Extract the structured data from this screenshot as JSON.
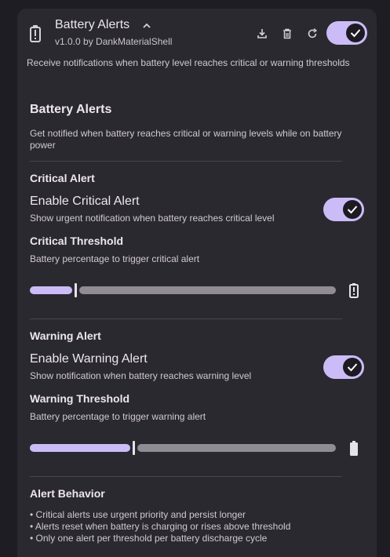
{
  "plugin": {
    "title": "Battery Alerts",
    "version": "v1.0.0 by DankMaterialShell",
    "description": "Receive notifications when battery level reaches critical or warning thresholds",
    "enabled": true,
    "icons": [
      "battery-alert-icon",
      "download-icon",
      "trash-icon",
      "refresh-icon",
      "check-icon"
    ]
  },
  "settings": {
    "title": "Battery Alerts",
    "description": "Get notified when battery reaches critical or warning levels while on battery power",
    "critical": {
      "heading": "Critical Alert",
      "enable_title": "Enable Critical Alert",
      "enable_desc": "Show urgent notification when battery reaches critical level",
      "enabled": true,
      "threshold_title": "Critical Threshold",
      "threshold_desc": "Battery percentage to trigger critical alert",
      "threshold_fraction": 0.145
    },
    "warning": {
      "heading": "Warning Alert",
      "enable_title": "Enable Warning Alert",
      "enable_desc": "Show notification when battery reaches warning level",
      "enabled": true,
      "threshold_title": "Warning Threshold",
      "threshold_desc": "Battery percentage to trigger warning alert",
      "threshold_fraction": 0.335
    },
    "behavior": {
      "heading": "Alert Behavior",
      "bullets": [
        "• Critical alerts use urgent priority and persist longer",
        "• Alerts reset when battery is charging or rises above threshold",
        "• Only one alert per threshold per battery discharge cycle"
      ]
    }
  },
  "colors": {
    "accent": "#cbbcf7",
    "background": "#1f1d24",
    "card": "#2b2930"
  }
}
